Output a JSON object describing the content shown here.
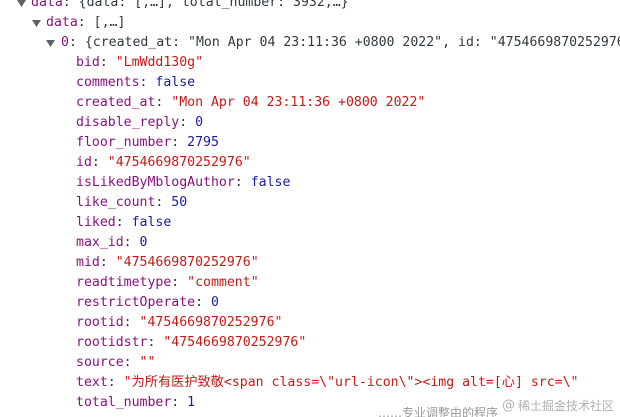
{
  "tree": {
    "root": {
      "key": "data",
      "preview": "{data: [,…], total_number: 3932,…}"
    },
    "data_array": {
      "key": "data",
      "preview": "[,…]"
    },
    "item0": {
      "key": "0",
      "preview": "{created_at: \"Mon Apr 04 23:11:36 +0800 2022\", id: \"4754669870252976\""
    },
    "properties": [
      {
        "key": "bid",
        "value": "\"LmWdd130g\"",
        "type": "string"
      },
      {
        "key": "comments",
        "value": "false",
        "type": "boolean"
      },
      {
        "key": "created_at",
        "value": "\"Mon Apr 04 23:11:36 +0800 2022\"",
        "type": "string"
      },
      {
        "key": "disable_reply",
        "value": "0",
        "type": "number"
      },
      {
        "key": "floor_number",
        "value": "2795",
        "type": "number"
      },
      {
        "key": "id",
        "value": "\"4754669870252976\"",
        "type": "string"
      },
      {
        "key": "isLikedByMblogAuthor",
        "value": "false",
        "type": "boolean"
      },
      {
        "key": "like_count",
        "value": "50",
        "type": "number"
      },
      {
        "key": "liked",
        "value": "false",
        "type": "boolean"
      },
      {
        "key": "max_id",
        "value": "0",
        "type": "number"
      },
      {
        "key": "mid",
        "value": "\"4754669870252976\"",
        "type": "string"
      },
      {
        "key": "readtimetype",
        "value": "\"comment\"",
        "type": "string"
      },
      {
        "key": "restrictOperate",
        "value": "0",
        "type": "number"
      },
      {
        "key": "rootid",
        "value": "\"4754669870252976\"",
        "type": "string"
      },
      {
        "key": "rootidstr",
        "value": "\"4754669870252976\"",
        "type": "string"
      },
      {
        "key": "source",
        "value": "\"\"",
        "type": "string"
      },
      {
        "key": "text",
        "value": "\"为所有医护致敬<span class=\\\"url-icon\\\"><img alt=[心] src=\\\"",
        "type": "string"
      },
      {
        "key": "total_number",
        "value": "1",
        "type": "number"
      }
    ]
  },
  "watermark": {
    "text": "稀土掘金技术社区",
    "icon": "at-sign-icon"
  },
  "stray_text": "……专业调整由的程序"
}
